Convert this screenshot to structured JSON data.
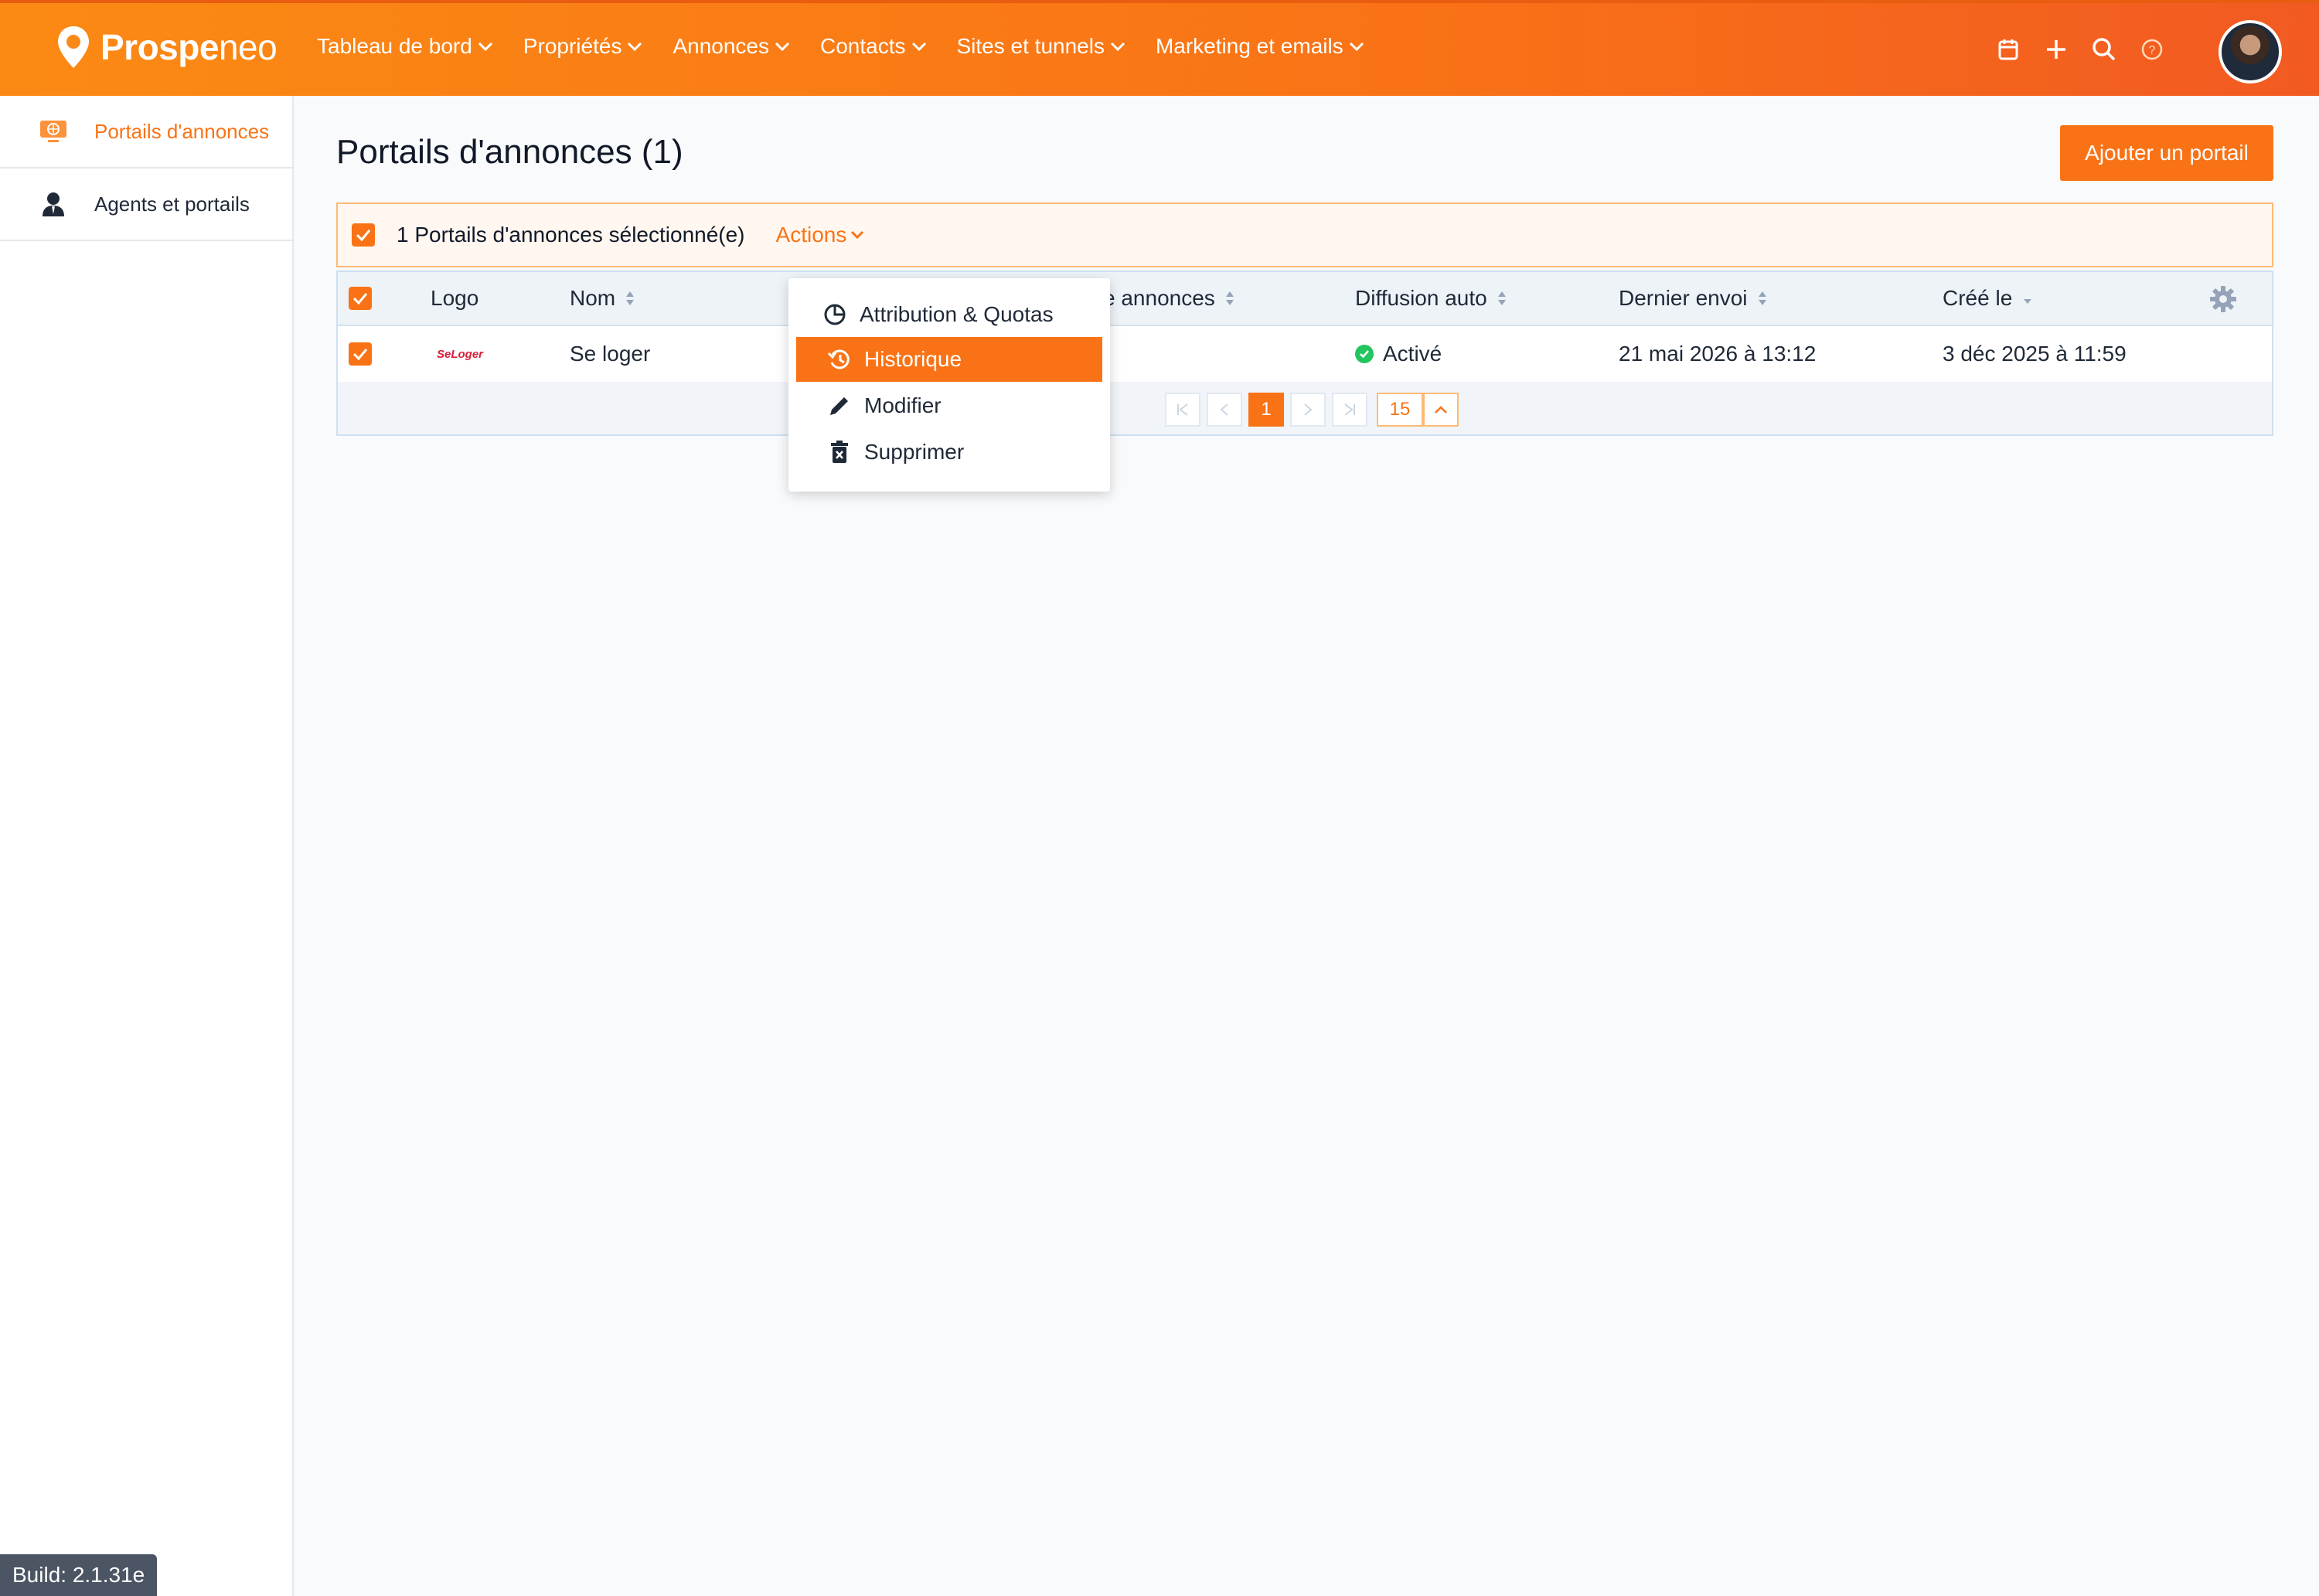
{
  "brand": {
    "name_bold": "Prospe",
    "name_light": "neo"
  },
  "nav": [
    {
      "label": "Tableau de bord"
    },
    {
      "label": "Propriétés"
    },
    {
      "label": "Annonces"
    },
    {
      "label": "Contacts"
    },
    {
      "label": "Sites et tunnels"
    },
    {
      "label": "Marketing et emails"
    }
  ],
  "top_icons": [
    "calendar-icon",
    "plus-icon",
    "search-icon",
    "help-icon"
  ],
  "sidebar": {
    "items": [
      {
        "label": "Portails d'annonces",
        "icon": "portal-icon",
        "active": true
      },
      {
        "label": "Agents et portails",
        "icon": "agent-icon",
        "active": false
      }
    ]
  },
  "page": {
    "title": "Portails d'annonces (1)",
    "add_button": "Ajouter un portail"
  },
  "selection": {
    "text": "1 Portails d'annonces sélectionné(e)",
    "actions_label": "Actions"
  },
  "table": {
    "columns": [
      "Logo",
      "Nom",
      "e annonces",
      "Diffusion auto",
      "Dernier envoi",
      "Créé le"
    ],
    "rows": [
      {
        "logo_text": "SeLoger",
        "nom": "Se loger",
        "diffusion": "Activé",
        "dernier_envoi": "21 mai 2026 à 13:12",
        "cree_le": "3 déc 2025 à 11:59"
      }
    ]
  },
  "pagination": {
    "current": "1",
    "page_size": "15"
  },
  "actions_menu": [
    {
      "label": "Attribution & Quotas",
      "icon": "pie-chart-icon"
    },
    {
      "label": "Historique",
      "icon": "history-icon",
      "highlighted": true
    },
    {
      "label": "Modifier",
      "icon": "pencil-icon"
    },
    {
      "label": "Supprimer",
      "icon": "trash-icon"
    }
  ],
  "build": "Build: 2.1.31e",
  "colors": {
    "accent": "#f97316",
    "success": "#22c55e"
  }
}
